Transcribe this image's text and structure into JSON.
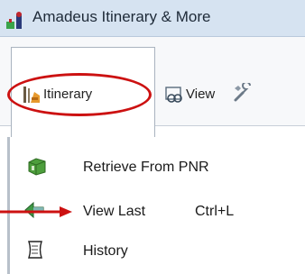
{
  "window": {
    "title": "Amadeus Itinerary & More"
  },
  "ribbon": {
    "tabs": [
      {
        "label": "Itinerary",
        "icon": "itinerary-icon",
        "selected": true
      },
      {
        "label": "View",
        "icon": "view-icon",
        "selected": false
      },
      {
        "label": "",
        "icon": "tools-icon",
        "selected": false
      }
    ]
  },
  "menu": {
    "items": [
      {
        "label": "Retrieve From PNR",
        "icon": "retrieve-icon",
        "shortcut": ""
      },
      {
        "label": "View Last",
        "icon": "view-last-icon",
        "shortcut": "Ctrl+L"
      },
      {
        "label": "History",
        "icon": "history-icon",
        "shortcut": ""
      }
    ]
  },
  "colors": {
    "annotation": "#cc1111",
    "titlebar": "#d6e3f1"
  }
}
